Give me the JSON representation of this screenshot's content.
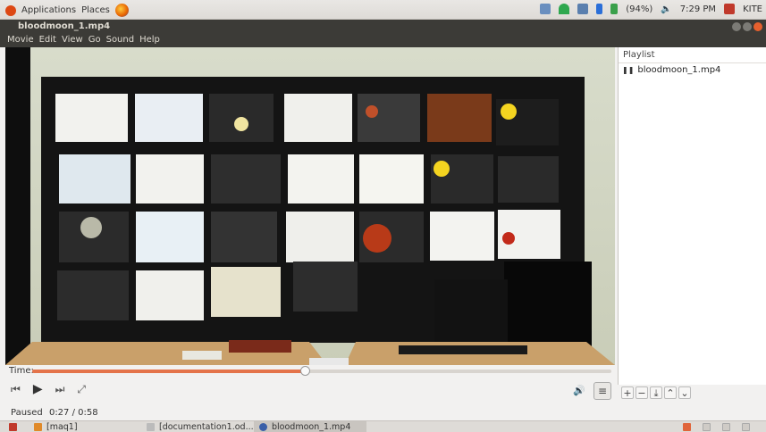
{
  "top_panel": {
    "applications": "Applications",
    "places": "Places",
    "battery": "(94%)",
    "time": "7:29 PM",
    "user": "KITE"
  },
  "window": {
    "title": "bloodmoon_1.mp4"
  },
  "menu": [
    "Movie",
    "Edit",
    "View",
    "Go",
    "Sound",
    "Help"
  ],
  "playlist": {
    "header": "Playlist",
    "items": [
      "bloodmoon_1.mp4"
    ]
  },
  "player": {
    "time_label": "Time:",
    "progress_fraction": 0.47,
    "status": "Paused",
    "elapsed": "0:27",
    "total": "0:58",
    "position_text": "0:27 / 0:58"
  },
  "taskbar": {
    "items": [
      "[maq1]",
      "[documentation1.od...",
      "bloodmoon_1.mp4"
    ]
  },
  "colors": {
    "accent": "#e4734a",
    "titlebar": "#3c3b37"
  }
}
